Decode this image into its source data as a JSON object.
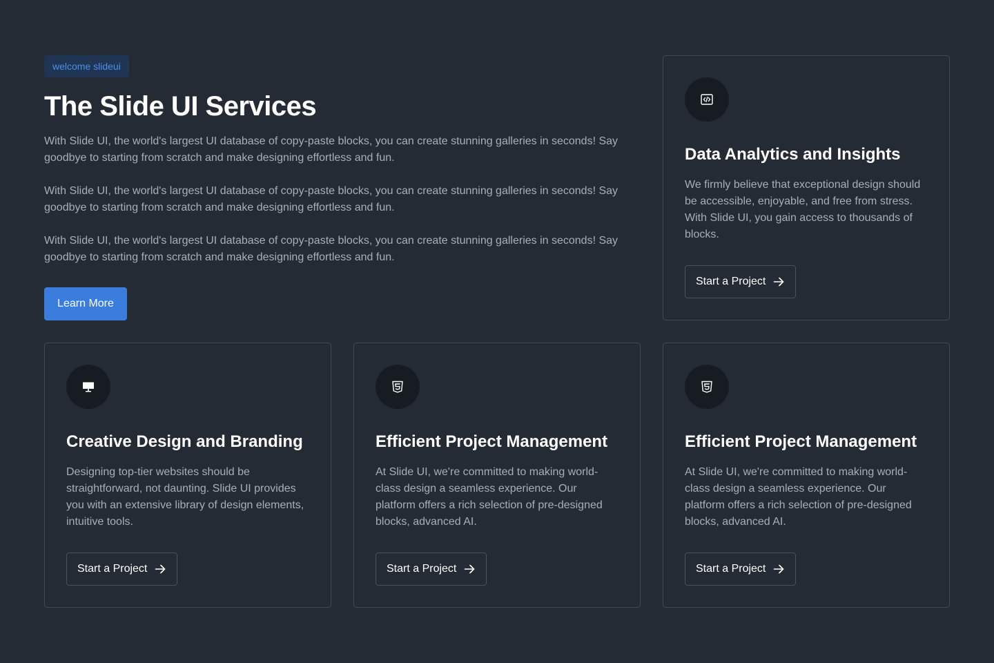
{
  "hero": {
    "badge": "welcome slideui",
    "title": "The Slide UI Services",
    "paragraphs": [
      "With Slide UI, the world's largest UI database of copy-paste blocks, you can create stunning galleries in seconds! Say goodbye to starting from scratch and make designing effortless and fun.",
      "With Slide UI, the world's largest UI database of copy-paste blocks, you can create stunning galleries in seconds! Say goodbye to starting from scratch and make designing effortless and fun.",
      "With Slide UI, the world's largest UI database of copy-paste blocks, you can create stunning galleries in seconds! Say goodbye to starting from scratch and make designing effortless and fun."
    ],
    "button_label": "Learn More"
  },
  "cards": [
    {
      "icon": "code-icon",
      "title": "Data Analytics and Insights",
      "description": "We firmly believe that exceptional design should be accessible, enjoyable, and free from stress. With Slide UI, you gain access to thousands of blocks.",
      "button_label": "Start a Project"
    },
    {
      "icon": "monitor-icon",
      "title": "Creative Design and Branding",
      "description": "Designing top-tier websites should be straightforward, not daunting. Slide UI provides you with an extensive library of design elements, intuitive tools.",
      "button_label": "Start a Project"
    },
    {
      "icon": "html5-icon",
      "title": "Efficient Project Management",
      "description": "At Slide UI, we're committed to making world-class design a seamless experience. Our platform offers a rich selection of pre-designed blocks, advanced AI.",
      "button_label": "Start a Project"
    },
    {
      "icon": "html5-icon",
      "title": "Efficient Project Management",
      "description": "At Slide UI, we're committed to making world-class design a seamless experience. Our platform offers a rich selection of pre-designed blocks, advanced AI.",
      "button_label": "Start a Project"
    }
  ],
  "colors": {
    "background": "#252b34",
    "accent": "#3b7ddd",
    "badge_text": "#4d8fe8",
    "card_border": "#404854",
    "icon_circle": "#171b22",
    "body_text": "#a7afbb"
  }
}
